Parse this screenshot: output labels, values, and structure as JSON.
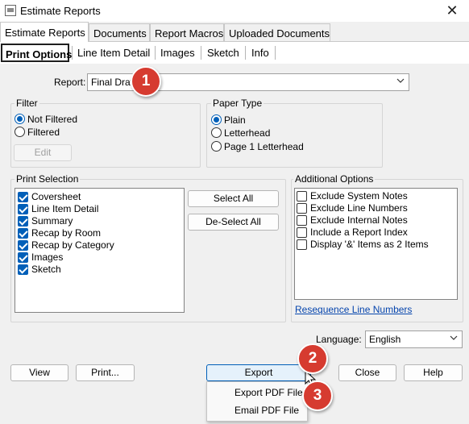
{
  "window": {
    "title": "Estimate Reports",
    "close_glyph": "✕"
  },
  "tabs": [
    "Estimate Reports",
    "Documents",
    "Report Macros",
    "Uploaded Documents"
  ],
  "subtabs": [
    "Print Options",
    "Line Item Detail",
    "Images",
    "Sketch",
    "Info"
  ],
  "report": {
    "label": "Report:",
    "value": "Final Draft"
  },
  "filter": {
    "title": "Filter",
    "options": [
      {
        "label": "Not Filtered",
        "selected": true
      },
      {
        "label": "Filtered",
        "selected": false
      }
    ],
    "edit_label": "Edit"
  },
  "paper_type": {
    "title": "Paper Type",
    "options": [
      {
        "label": "Plain",
        "selected": true
      },
      {
        "label": "Letterhead",
        "selected": false
      },
      {
        "label": "Page 1 Letterhead",
        "selected": false
      }
    ]
  },
  "print_selection": {
    "title": "Print Selection",
    "items": [
      {
        "label": "Coversheet",
        "checked": true
      },
      {
        "label": "Line Item Detail",
        "checked": true
      },
      {
        "label": "Summary",
        "checked": true
      },
      {
        "label": "Recap by Room",
        "checked": true
      },
      {
        "label": "Recap by Category",
        "checked": true
      },
      {
        "label": "Images",
        "checked": true
      },
      {
        "label": "Sketch",
        "checked": true
      }
    ],
    "select_all": "Select All",
    "deselect_all": "De-Select All"
  },
  "additional_options": {
    "title": "Additional Options",
    "items": [
      {
        "label": "Exclude System Notes",
        "checked": false
      },
      {
        "label": "Exclude Line Numbers",
        "checked": false
      },
      {
        "label": "Exclude Internal Notes",
        "checked": false
      },
      {
        "label": "Include a Report Index",
        "checked": false
      },
      {
        "label": "Display '&' Items as 2 Items",
        "checked": false
      }
    ],
    "resequence_link": "Resequence Line Numbers"
  },
  "language": {
    "label": "Language:",
    "value": "English"
  },
  "buttons": {
    "view": "View",
    "print": "Print...",
    "export": "Export",
    "close": "Close",
    "help": "Help"
  },
  "export_menu": {
    "items": [
      "Export PDF File",
      "Email PDF File"
    ]
  },
  "badges": [
    "1",
    "2",
    "3"
  ],
  "colors": {
    "accent": "#005fb8",
    "badge": "#d63b30",
    "link": "#0645ad"
  },
  "icons": {
    "app": "app-icon",
    "close": "close-icon",
    "dropdown": "chevron-down-icon",
    "cursor": "mouse-pointer-icon"
  }
}
